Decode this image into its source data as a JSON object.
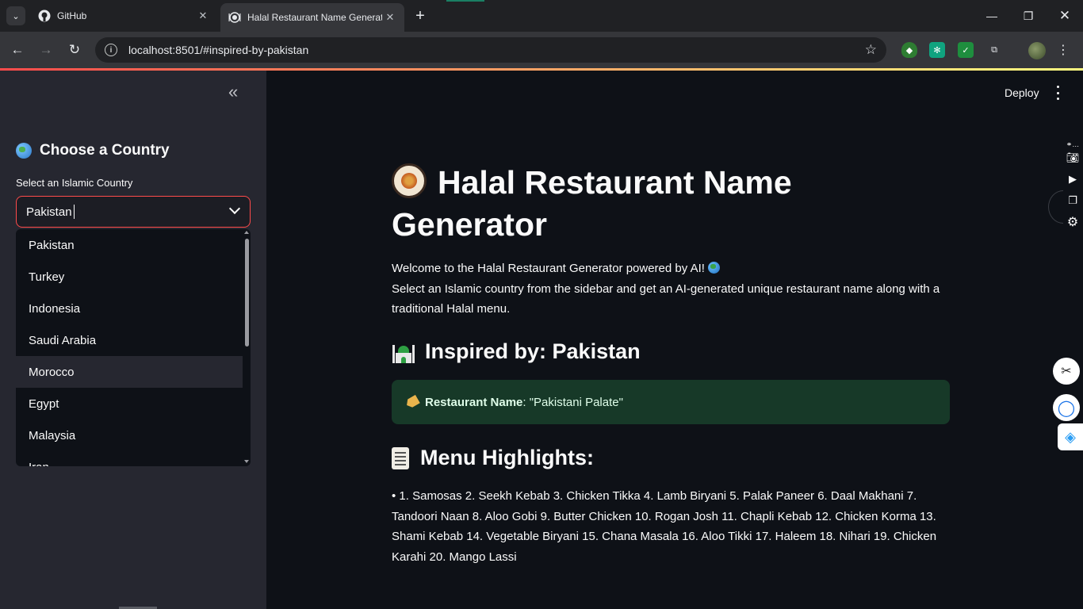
{
  "browser": {
    "tabs": [
      {
        "title": "GitHub",
        "icon": "github-icon"
      },
      {
        "title": "Halal Restaurant Name Generator",
        "icon": "plate-icon"
      }
    ],
    "url": "localhost:8501/#inspired-by-pakistan"
  },
  "app": {
    "deploy_label": "Deploy"
  },
  "sidebar": {
    "header": "Choose a Country",
    "select_label": "Select an Islamic Country",
    "select_value": "Pakistan",
    "options": [
      "Pakistan",
      "Turkey",
      "Indonesia",
      "Saudi Arabia",
      "Morocco",
      "Egypt",
      "Malaysia",
      "Iran"
    ],
    "hovered_option": "Morocco"
  },
  "main": {
    "title": "Halal Restaurant Name Generator",
    "welcome_line1": "Welcome to the Halal Restaurant Generator powered by AI!",
    "welcome_line2": "Select an Islamic country from the sidebar and get an AI-generated unique restaurant name along with a traditional Halal menu.",
    "inspired_heading": "Inspired by: Pakistan",
    "restaurant_label": "Restaurant Name",
    "restaurant_value": ": \"Pakistani Palate\"",
    "menu_heading": "Menu Highlights:",
    "menu_text": "• 1. Samosas 2. Seekh Kebab 3. Chicken Tikka 4. Lamb Biryani 5. Palak Paneer 6. Daal Makhani 7. Tandoori Naan 8. Aloo Gobi 9. Butter Chicken 10. Rogan Josh 11. Chapli Kebab 12. Chicken Korma 13. Shami Kebab 14. Vegetable Biryani 15. Chana Masala 16. Aloo Tikki 17. Haleem 18. Nihari 19. Chicken Karahi 20. Mango Lassi"
  },
  "colors": {
    "accent": "#ff4b4b",
    "sidebar_bg": "#262730",
    "main_bg": "#0e1117",
    "success_bg": "#173928"
  }
}
